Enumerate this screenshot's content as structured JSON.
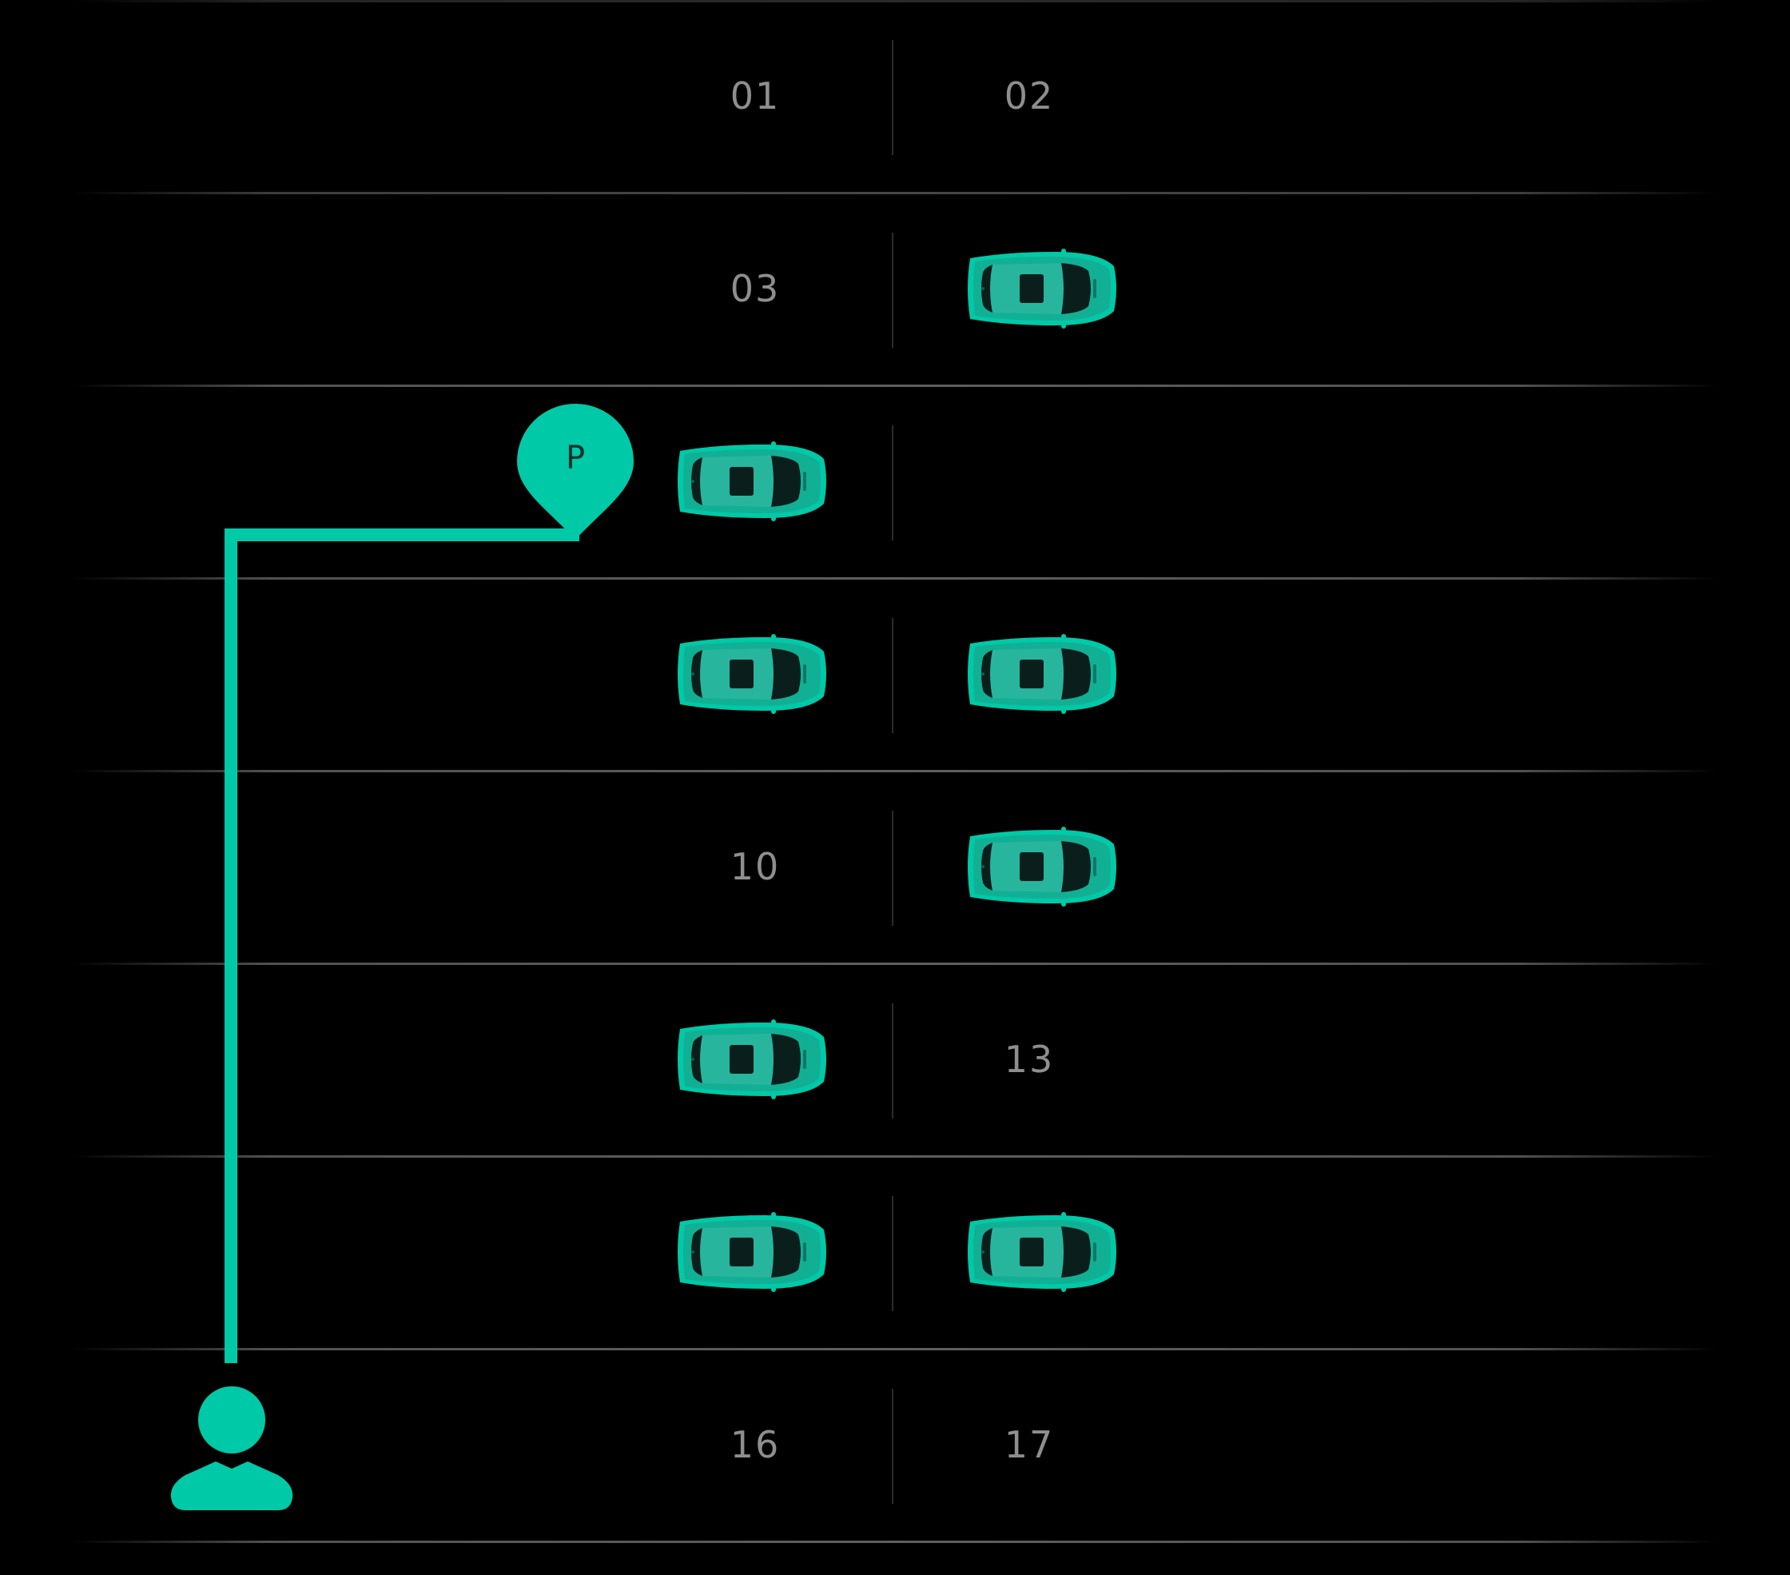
{
  "parking_map": {
    "accent_color": "#00c9a7",
    "background_color": "#000000",
    "spot_number_color": "#8e8e8e",
    "target_marker": {
      "label": "P",
      "icon": "location-pin-icon"
    },
    "user_marker": {
      "icon": "person-icon"
    },
    "route": {
      "icon": "route-path"
    },
    "rows": [
      {
        "left": {
          "occupied": false,
          "number": "01"
        },
        "right": {
          "occupied": false,
          "number": "02"
        }
      },
      {
        "left": {
          "occupied": false,
          "number": "03"
        },
        "right": {
          "occupied": true
        }
      },
      {
        "left": {
          "occupied": true,
          "target": true
        },
        "right": {
          "occupied": false
        }
      },
      {
        "left": {
          "occupied": true
        },
        "right": {
          "occupied": true
        }
      },
      {
        "left": {
          "occupied": false,
          "number": "10"
        },
        "right": {
          "occupied": true
        }
      },
      {
        "left": {
          "occupied": true
        },
        "right": {
          "occupied": false,
          "number": "13"
        }
      },
      {
        "left": {
          "occupied": true
        },
        "right": {
          "occupied": true
        }
      },
      {
        "left": {
          "occupied": false,
          "number": "16"
        },
        "right": {
          "occupied": false,
          "number": "17"
        }
      }
    ]
  }
}
